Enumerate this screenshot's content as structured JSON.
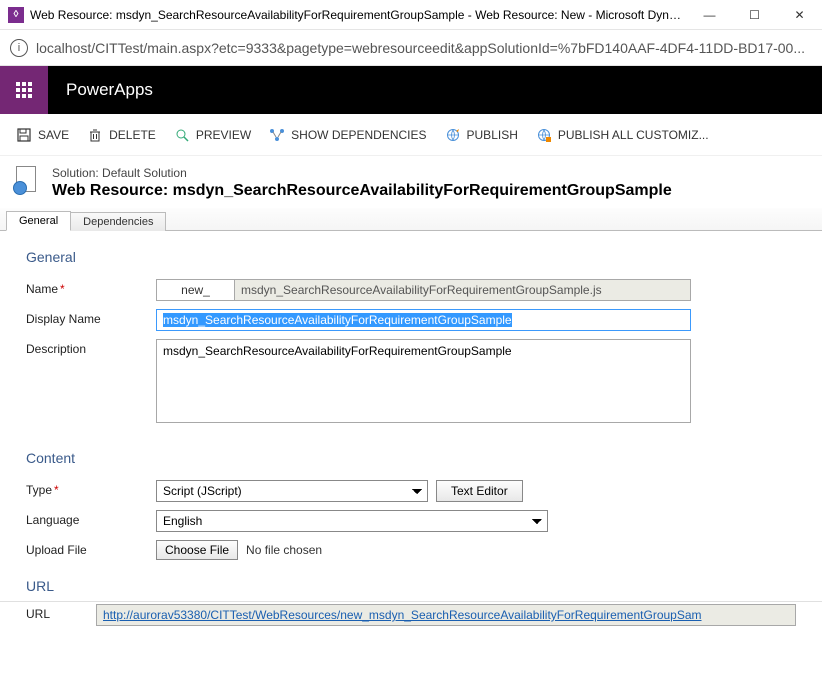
{
  "titlebar": {
    "text": "Web Resource: msdyn_SearchResourceAvailabilityForRequirementGroupSample - Web Resource: New - Microsoft Dynamic..."
  },
  "address": "localhost/CITTest/main.aspx?etc=9333&pagetype=webresourceedit&appSolutionId=%7bFD140AAF-4DF4-11DD-BD17-00...",
  "brand": "PowerApps",
  "cmds": {
    "save": "SAVE",
    "delete": "DELETE",
    "preview": "PREVIEW",
    "showdeps": "SHOW DEPENDENCIES",
    "publish": "PUBLISH",
    "publishall": "PUBLISH ALL CUSTOMIZ..."
  },
  "header": {
    "solution_line": "Solution: Default Solution",
    "title": "Web Resource: msdyn_SearchResourceAvailabilityForRequirementGroupSample"
  },
  "tabs": {
    "general": "General",
    "deps": "Dependencies"
  },
  "general": {
    "section": "General",
    "name_lbl": "Name",
    "name_prefix": "new_",
    "name_val": "msdyn_SearchResourceAvailabilityForRequirementGroupSample.js",
    "display_lbl": "Display Name",
    "display_val": "msdyn_SearchResourceAvailabilityForRequirementGroupSample",
    "desc_lbl": "Description",
    "desc_val": "msdyn_SearchResourceAvailabilityForRequirementGroupSample"
  },
  "content": {
    "section": "Content",
    "type_lbl": "Type",
    "type_val": "Script (JScript)",
    "te_btn": "Text Editor",
    "lang_lbl": "Language",
    "lang_val": "English",
    "upload_lbl": "Upload File",
    "choose_btn": "Choose File",
    "no_file": "No file chosen"
  },
  "url": {
    "section": "URL",
    "lbl": "URL",
    "val": "http://aurorav53380/CITTest/WebResources/new_msdyn_SearchResourceAvailabilityForRequirementGroupSam"
  }
}
